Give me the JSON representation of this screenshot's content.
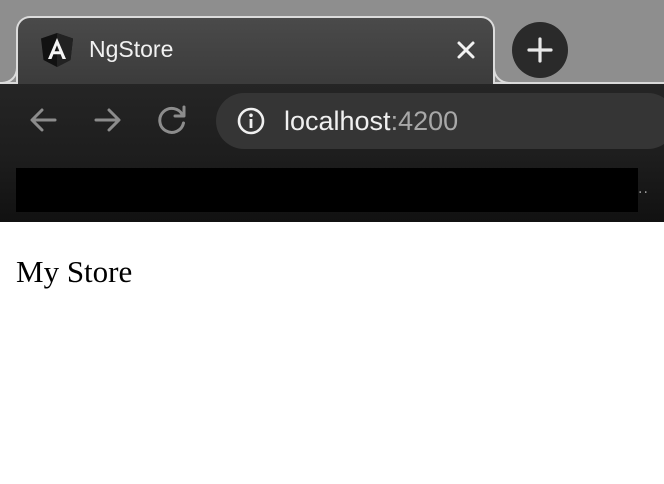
{
  "browser": {
    "tab": {
      "title": "NgStore",
      "favicon": "angular-logo-icon",
      "close_icon": "close-icon"
    },
    "new_tab_icon": "plus-icon",
    "toolbar": {
      "back_icon": "arrow-left-icon",
      "forward_icon": "arrow-right-icon",
      "reload_icon": "reload-icon",
      "site_info_icon": "info-icon",
      "url_host": "localhost",
      "url_port": ":4200"
    },
    "bookmarks_overflow": ".."
  },
  "page": {
    "heading": "My Store"
  },
  "colors": {
    "tabstrip_bg": "#8e8e8e",
    "active_tab_bg": "#444444",
    "toolbar_bg": "#1c1c1c",
    "omnibox_bg": "#353535",
    "page_bg": "#ffffff"
  }
}
